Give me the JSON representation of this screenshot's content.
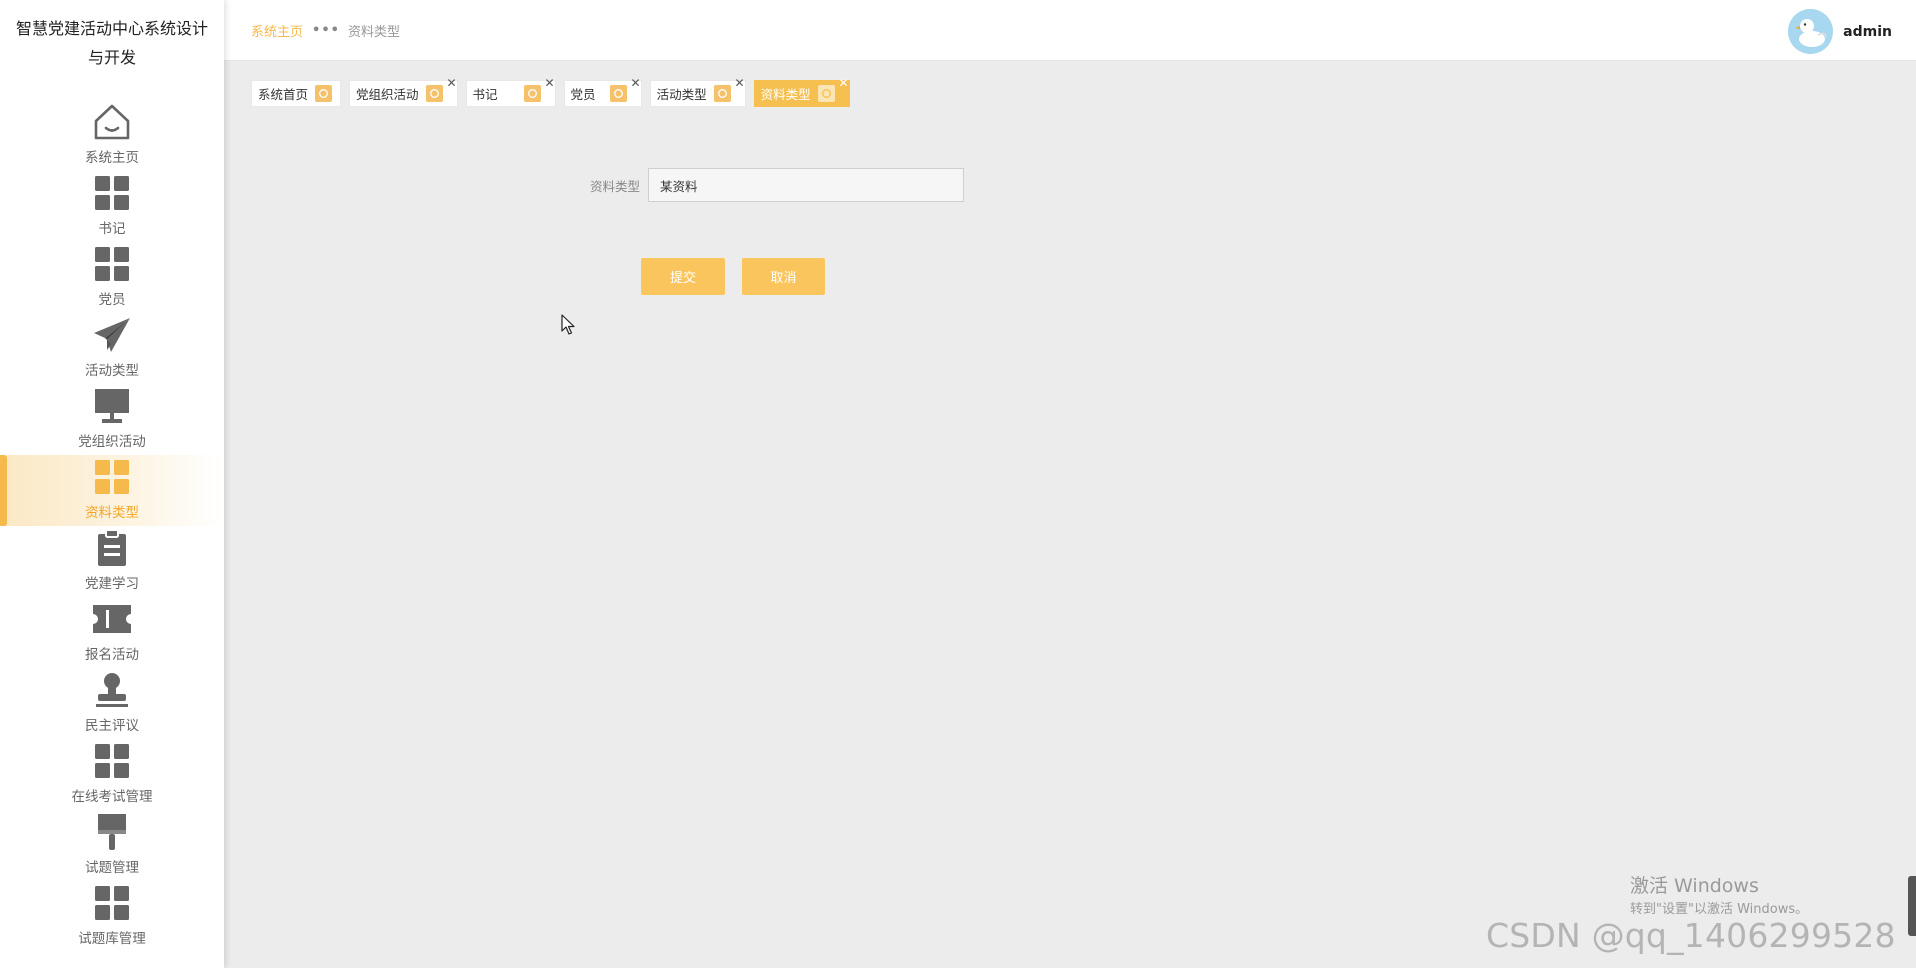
{
  "sidebar": {
    "title": "智慧党建活动中心系统设计与开发",
    "items": [
      {
        "label": "系统主页",
        "icon": "home-icon",
        "active": false
      },
      {
        "label": "书记",
        "icon": "grid-icon",
        "active": false
      },
      {
        "label": "党员",
        "icon": "grid-icon",
        "active": false
      },
      {
        "label": "活动类型",
        "icon": "paper-plane-icon",
        "active": false
      },
      {
        "label": "党组织活动",
        "icon": "monitor-icon",
        "active": false
      },
      {
        "label": "资料类型",
        "icon": "grid-icon",
        "active": true
      },
      {
        "label": "党建学习",
        "icon": "clipboard-icon",
        "active": false
      },
      {
        "label": "报名活动",
        "icon": "ticket-icon",
        "active": false
      },
      {
        "label": "民主评议",
        "icon": "stamp-icon",
        "active": false
      },
      {
        "label": "在线考试管理",
        "icon": "grid-icon",
        "active": false
      },
      {
        "label": "试题管理",
        "icon": "brush-icon",
        "active": false
      },
      {
        "label": "试题库管理",
        "icon": "grid-icon",
        "active": false
      }
    ]
  },
  "header": {
    "breadcrumb_home": "系统主页",
    "breadcrumb_current": "资料类型",
    "username": "admin",
    "avatar_icon": "duck-icon"
  },
  "tags": [
    {
      "label": "系统首页",
      "closable": false,
      "active": false
    },
    {
      "label": "党组织活动",
      "closable": true,
      "active": false
    },
    {
      "label": "书记",
      "closable": true,
      "active": false
    },
    {
      "label": "党员",
      "closable": true,
      "active": false
    },
    {
      "label": "活动类型",
      "closable": true,
      "active": false
    },
    {
      "label": "资料类型",
      "closable": true,
      "active": true
    }
  ],
  "form": {
    "field_label": "资料类型",
    "field_value": "某资料",
    "submit_label": "提交",
    "cancel_label": "取消"
  },
  "overlay": {
    "windows_activate_title": "激活 Windows",
    "windows_activate_sub": "转到\"设置\"以激活 Windows。",
    "csdn_watermark": "CSDN @qq_1406299528"
  },
  "colors": {
    "accent": "#f5b94c",
    "icon_gray": "#666666",
    "active_text": "#f5a623"
  }
}
